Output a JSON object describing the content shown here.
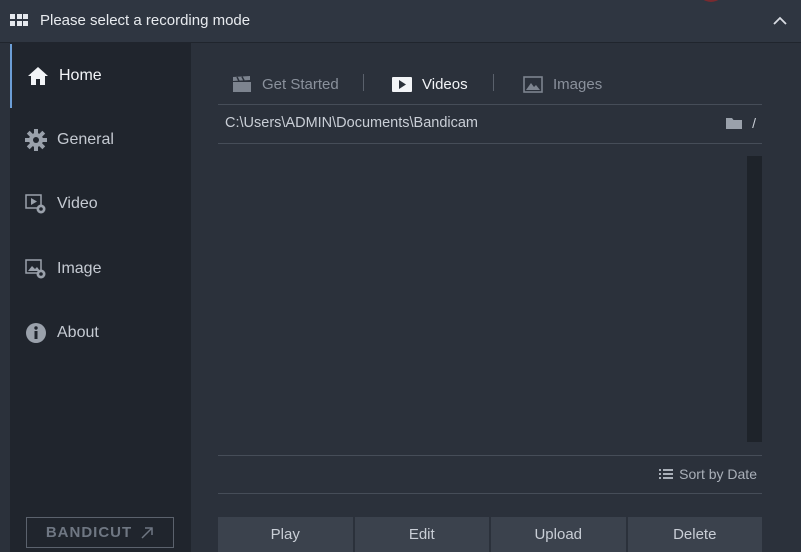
{
  "window": {
    "title": "Please select a recording mode"
  },
  "sidebar": {
    "items": [
      {
        "label": "Home",
        "icon": "home-icon",
        "active": true
      },
      {
        "label": "General",
        "icon": "gear-icon"
      },
      {
        "label": "Video",
        "icon": "video-settings-icon"
      },
      {
        "label": "Image",
        "icon": "image-settings-icon"
      },
      {
        "label": "About",
        "icon": "info-icon"
      }
    ],
    "bandicut": {
      "part1": "BANDI",
      "part2": "CUT"
    }
  },
  "tabs": [
    {
      "label": "Get Started",
      "icon": "clapperboard-icon"
    },
    {
      "label": "Videos",
      "icon": "play-icon",
      "active": true
    },
    {
      "label": "Images",
      "icon": "picture-icon"
    }
  ],
  "path": {
    "value": "C:\\Users\\ADMIN\\Documents\\Bandicam",
    "slash": "/"
  },
  "sort": {
    "label": "Sort by Date"
  },
  "actions": {
    "play": "Play",
    "edit": "Edit",
    "upload": "Upload",
    "delete": "Delete"
  },
  "colors": {
    "accent": "#6c9ed6",
    "sidebar_bg": "#20252d",
    "main_bg": "#2b313b"
  }
}
